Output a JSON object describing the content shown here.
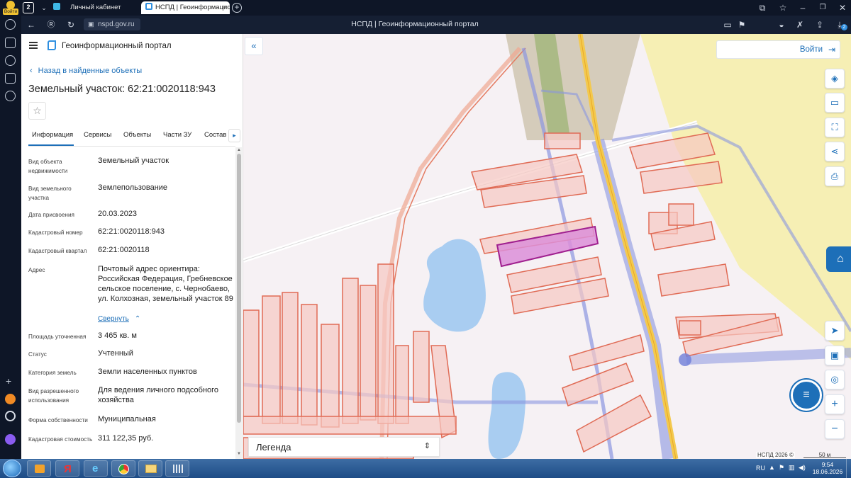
{
  "browser": {
    "login_badge": "Войти",
    "tab_counter": "2",
    "tabs": [
      {
        "title": "Личный кабинет"
      },
      {
        "title": "НСПД | Геоинформацио"
      }
    ],
    "url": "nspd.gov.ru",
    "page_title": "НСПД | Геоинформационный портал",
    "downloads_badge": "2"
  },
  "portal": {
    "title": "Геоинформационный портал",
    "back_link": "Назад в найденные объекты",
    "object_title": "Земельный участок: 62:21:0020118:943",
    "tabs": [
      "Информация",
      "Сервисы",
      "Объекты",
      "Части ЗУ",
      "Состав"
    ],
    "active_tab": 0,
    "fields": [
      {
        "label": "Вид объекта недвижимости",
        "value": "Земельный участок"
      },
      {
        "label": "Вид земельного участка",
        "value": "Землепользование"
      },
      {
        "label": "Дата присвоения",
        "value": "20.03.2023"
      },
      {
        "label": "Кадастровый номер",
        "value": "62:21:0020118:943"
      },
      {
        "label": "Кадастровый квартал",
        "value": "62:21:0020118"
      },
      {
        "label": "Адрес",
        "value": "Почтовый адрес ориентира: Российская Федерация, Гребневское сельское поселение, с. Чернобаево, ул. Колхозная, земельный участок 89"
      },
      {
        "label": "Площадь уточненная",
        "value": "3 465 кв. м"
      },
      {
        "label": "Статус",
        "value": "Учтенный"
      },
      {
        "label": "Категория земель",
        "value": "Земли населенных пунктов"
      },
      {
        "label": "Вид разрешенного использования",
        "value": "Для ведения личного подсобного хозяйства"
      },
      {
        "label": "Форма собственности",
        "value": "Муниципальная"
      },
      {
        "label": "Кадастровая стоимость",
        "value": "311 122,35 руб."
      }
    ],
    "collapse_link": "Свернуть"
  },
  "map": {
    "login_button": "Войти",
    "legend_label": "Легенда",
    "attribution": "НСПД 2026 ©",
    "scale_label": "50 м",
    "colors": {
      "parcel_fill": "#f7c7c2",
      "parcel_stroke": "#e06b55",
      "selected_fill": "#dc8fd8",
      "selected_stroke": "#a0208f",
      "road_blue": "#8b96e0",
      "water": "#a9cdf1",
      "field_yellow": "#f6efb4",
      "accent": "#1d6fb8"
    }
  },
  "taskbar": {
    "language": "RU",
    "time": "9:54",
    "date": "18.06.2026"
  }
}
